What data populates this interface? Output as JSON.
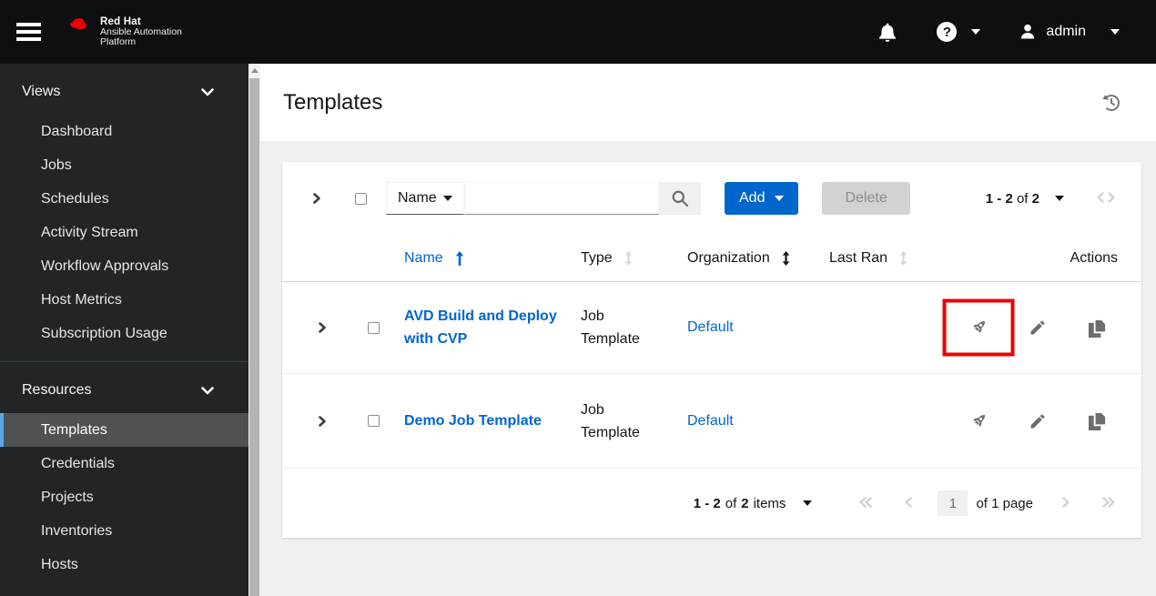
{
  "masthead": {
    "brand": {
      "line1": "Red Hat",
      "line2": "Ansible Automation",
      "line3": "Platform"
    },
    "help_glyph": "?",
    "user": "admin"
  },
  "sidebar": {
    "sections": [
      {
        "label": "Views",
        "items": [
          "Dashboard",
          "Jobs",
          "Schedules",
          "Activity Stream",
          "Workflow Approvals",
          "Host Metrics",
          "Subscription Usage"
        ]
      },
      {
        "label": "Resources",
        "items": [
          "Templates",
          "Credentials",
          "Projects",
          "Inventories",
          "Hosts"
        ],
        "active_item": "Templates"
      }
    ]
  },
  "page": {
    "title": "Templates"
  },
  "toolbar": {
    "filter": "Name",
    "add": "Add",
    "delete": "Delete",
    "pagination": {
      "range": "1 - 2",
      "of": "of",
      "total": "2"
    }
  },
  "table": {
    "columns": [
      "Name",
      "Type",
      "Organization",
      "Last Ran",
      "Actions"
    ],
    "rows": [
      {
        "name": "AVD Build and Deploy with CVP",
        "type": "Job Template",
        "organization": "Default",
        "last_ran": ""
      },
      {
        "name": "Demo Job Template",
        "type": "Job Template",
        "organization": "Default",
        "last_ran": ""
      }
    ]
  },
  "footer": {
    "range": "1 - 2",
    "of": "of",
    "total": "2",
    "items": "items",
    "page": "1",
    "page_of": "of 1 page"
  },
  "colors": {
    "accent": "#0066cc",
    "link": "#0066cc",
    "masthead_bg": "#0e0f12",
    "sidebar_bg": "#212528",
    "nav_active_bg": "#4f5255",
    "nav_active_border": "#5ba8e8",
    "highlight_box": "#ee0000",
    "icon_gray": "#6a6e73"
  }
}
